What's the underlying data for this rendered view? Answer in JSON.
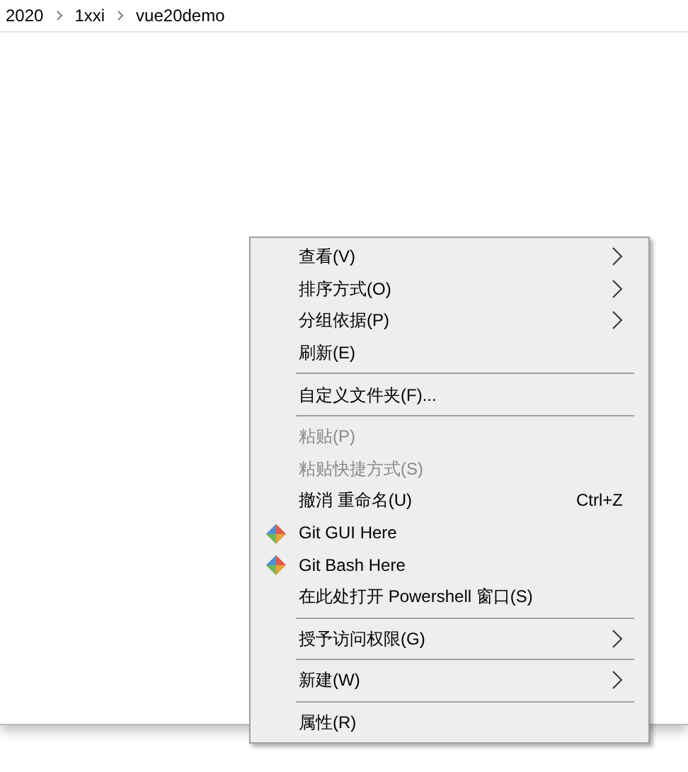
{
  "breadcrumb": [
    "2020",
    "1xxi",
    "vue20demo"
  ],
  "context_menu": [
    {
      "kind": "item",
      "label": "查看(V)",
      "submenu": true,
      "disabled": false
    },
    {
      "kind": "item",
      "label": "排序方式(O)",
      "submenu": true,
      "disabled": false
    },
    {
      "kind": "item",
      "label": "分组依据(P)",
      "submenu": true,
      "disabled": false
    },
    {
      "kind": "item",
      "label": "刷新(E)",
      "submenu": false,
      "disabled": false
    },
    {
      "kind": "separator"
    },
    {
      "kind": "item",
      "label": "自定义文件夹(F)...",
      "submenu": false,
      "disabled": false
    },
    {
      "kind": "separator"
    },
    {
      "kind": "item",
      "label": "粘贴(P)",
      "submenu": false,
      "disabled": true
    },
    {
      "kind": "item",
      "label": "粘贴快捷方式(S)",
      "submenu": false,
      "disabled": true
    },
    {
      "kind": "item",
      "label": "撤消 重命名(U)",
      "shortcut": "Ctrl+Z",
      "submenu": false,
      "disabled": false
    },
    {
      "kind": "git_item",
      "label": "Git GUI Here",
      "submenu": false,
      "disabled": false
    },
    {
      "kind": "git_item",
      "label": "Git Bash Here",
      "submenu": false,
      "disabled": false
    },
    {
      "kind": "item",
      "label": "在此处打开 Powershell 窗口(S)",
      "submenu": false,
      "disabled": false
    },
    {
      "kind": "separator"
    },
    {
      "kind": "item",
      "label": "授予访问权限(G)",
      "submenu": true,
      "disabled": false
    },
    {
      "kind": "separator"
    },
    {
      "kind": "item",
      "label": "新建(W)",
      "submenu": true,
      "disabled": false
    },
    {
      "kind": "separator"
    },
    {
      "kind": "item",
      "label": "属性(R)",
      "submenu": false,
      "disabled": false
    }
  ]
}
